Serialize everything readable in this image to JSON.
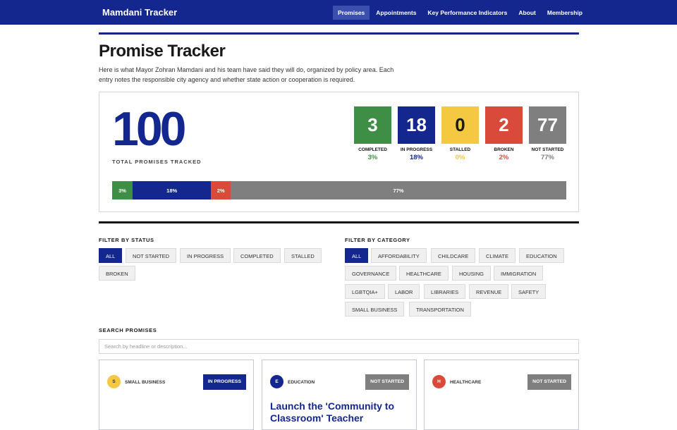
{
  "app": {
    "brand": "Mamdani Tracker"
  },
  "nav": [
    {
      "label": "Promises",
      "active": true
    },
    {
      "label": "Appointments"
    },
    {
      "label": "Key Performance Indicators"
    },
    {
      "label": "About"
    },
    {
      "label": "Membership"
    }
  ],
  "page": {
    "title": "Promise Tracker",
    "intro": "Here is what Mayor Zohran Mamdani and his team have said they will do, organized by policy area. Each entry notes the responsible city agency and whether state action or cooperation is required."
  },
  "summary": {
    "total": "100",
    "total_label": "TOTAL PROMISES TRACKED",
    "stats": [
      {
        "value": "3",
        "label": "COMPLETED",
        "pct": "3%",
        "color": "#3e8f45"
      },
      {
        "value": "18",
        "label": "IN PROGRESS",
        "pct": "18%",
        "color": "#13278f"
      },
      {
        "value": "0",
        "label": "STALLED",
        "pct": "0%",
        "color": "#f5c842"
      },
      {
        "value": "2",
        "label": "BROKEN",
        "pct": "2%",
        "color": "#d94a3a"
      },
      {
        "value": "77",
        "label": "NOT STARTED",
        "pct": "77%",
        "color": "#7f7f7f"
      }
    ],
    "bar": [
      {
        "label": "3%",
        "share": 0.045,
        "color": "#3e8f45"
      },
      {
        "label": "18%",
        "share": 0.173,
        "color": "#13278f"
      },
      {
        "label": "2%",
        "share": 0.043,
        "color": "#d94a3a"
      },
      {
        "label": "77%",
        "share": 0.739,
        "color": "#7f7f7f"
      }
    ]
  },
  "filters": {
    "status_title": "FILTER BY STATUS",
    "status": [
      "ALL",
      "NOT STARTED",
      "IN PROGRESS",
      "COMPLETED",
      "STALLED",
      "BROKEN"
    ],
    "category_title": "FILTER BY CATEGORY",
    "category": [
      "ALL",
      "AFFORDABILITY",
      "CHILDCARE",
      "CLIMATE",
      "EDUCATION",
      "GOVERNANCE",
      "HEALTHCARE",
      "HOUSING",
      "IMMIGRATION",
      "LGBTQIA+",
      "LABOR",
      "LIBRARIES",
      "REVENUE",
      "SAFETY",
      "SMALL BUSINESS",
      "TRANSPORTATION"
    ]
  },
  "search": {
    "title": "SEARCH PROMISES",
    "placeholder": "Search by headline or description..."
  },
  "cards": [
    {
      "initial": "S",
      "category": "SMALL BUSINESS",
      "status": "IN PROGRESS",
      "status_color": "#13278f",
      "avatar_color": "#f5c842",
      "avatar_text": "#333333",
      "headline": ""
    },
    {
      "initial": "E",
      "category": "EDUCATION",
      "status": "NOT STARTED",
      "status_color": "#7f7f7f",
      "avatar_color": "#13278f",
      "avatar_text": "#ffffff",
      "headline": "Launch the 'Community to Classroom' Teacher"
    },
    {
      "initial": "H",
      "category": "HEALTHCARE",
      "status": "NOT STARTED",
      "status_color": "#7f7f7f",
      "avatar_color": "#d94a3a",
      "avatar_text": "#ffffff",
      "headline": ""
    }
  ]
}
